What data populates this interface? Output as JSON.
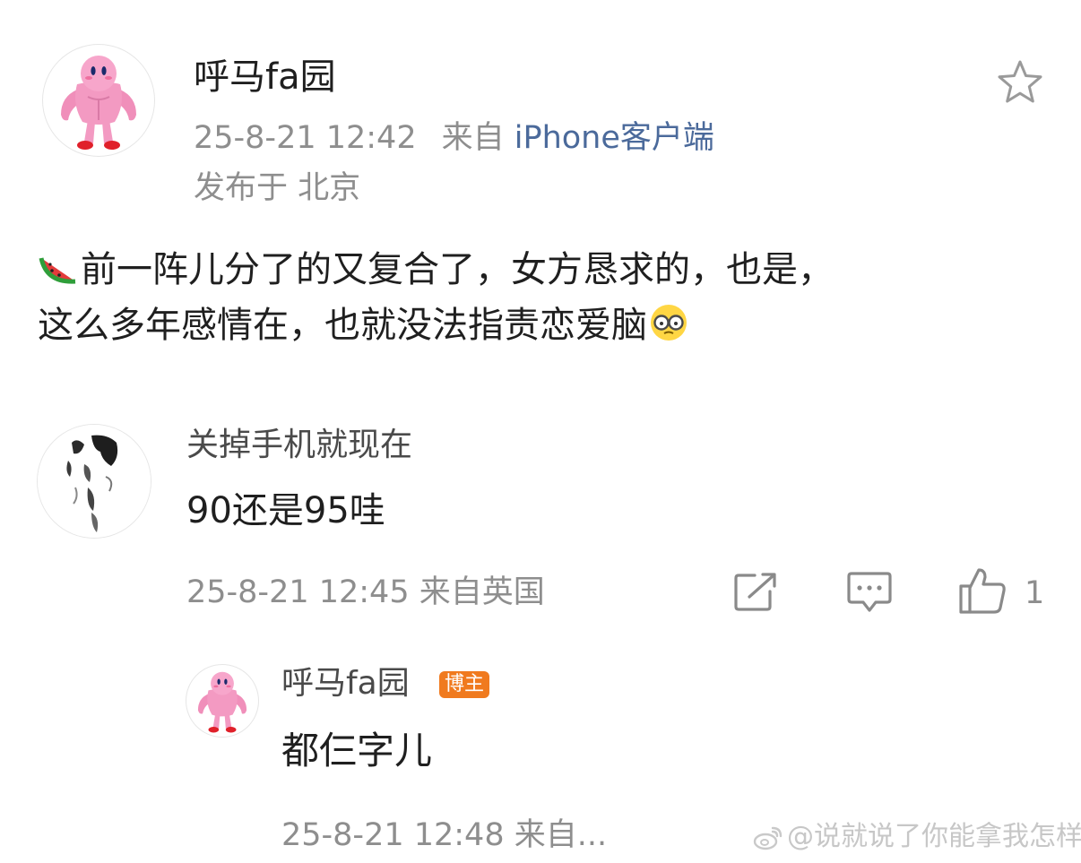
{
  "post": {
    "author": "呼马fa园",
    "time": "25-8-21 12:42",
    "source_prefix": "来自",
    "source_client": "iPhone客户端",
    "location": "发布于 北京",
    "content_line1": "前一阵儿分了的又复合了，女方恳求的，也是，",
    "content_line2": "这么多年感情在，也就没法指责恋爱脑",
    "icons": {
      "lead_emoji": "watermelon-icon",
      "trail_emoji": "glasses-face-icon",
      "favorite": "star-icon"
    }
  },
  "comment": {
    "author": "关掉手机就现在",
    "text": "90还是95哇",
    "time": "25-8-21 12:45",
    "source": "来自英国",
    "like_count": "1",
    "icons": {
      "share": "share-icon",
      "reply": "comment-icon",
      "like": "thumbs-up-icon"
    }
  },
  "reply": {
    "author": "呼马fa园",
    "badge": "博主",
    "text": "都仨字儿",
    "time": "25-8-21 12:48",
    "source": "来自..."
  },
  "watermark": {
    "text": "@说就说了你能拿我怎样",
    "icon": "weibo-logo-icon"
  },
  "colors": {
    "link": "#4b6a9b",
    "meta": "#8e8e8e",
    "badge": "#f07a1e",
    "avatar_pink": "#f39ac2"
  }
}
